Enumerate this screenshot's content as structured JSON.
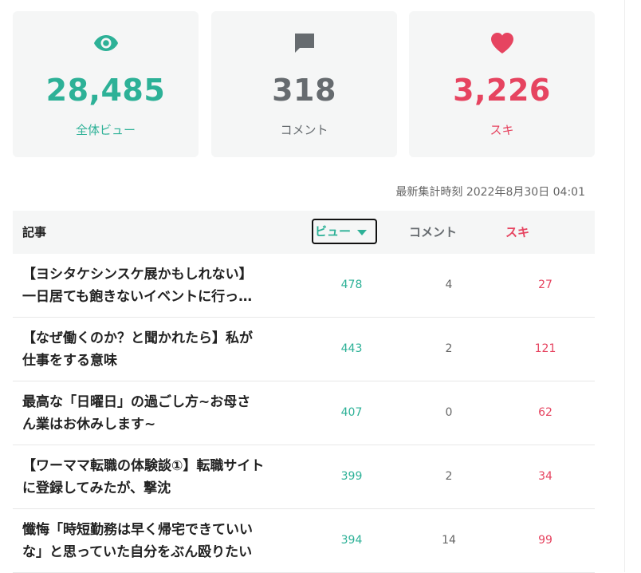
{
  "stats": [
    {
      "icon": "eye-icon",
      "value": "28,485",
      "label": "全体ビュー",
      "color": "#2db197"
    },
    {
      "icon": "comment-icon",
      "value": "318",
      "label": "コメント",
      "color": "#666b6f"
    },
    {
      "icon": "heart-icon",
      "value": "3,226",
      "label": "スキ",
      "color": "#e64460"
    }
  ],
  "timestamp": "最新集計時刻 2022年8月30日 04:01",
  "table": {
    "headers": {
      "title": "記事",
      "views": "ビュー",
      "comments": "コメント",
      "likes": "スキ"
    },
    "rows": [
      {
        "line1": "【ヨシタケシンスケ展かもしれない】",
        "line2": "一日居ても飽きないイベントに行っ…",
        "views": "478",
        "comments": "4",
        "likes": "27"
      },
      {
        "line1": "【なぜ働くのか？と聞かれたら】私が",
        "line2": "仕事をする意味",
        "views": "443",
        "comments": "2",
        "likes": "121"
      },
      {
        "line1": "最高な「日曜日」の過ごし方~お母さ",
        "line2": "ん業はお休みします~",
        "views": "407",
        "comments": "0",
        "likes": "62"
      },
      {
        "line1": "【ワーママ転職の体験談①】転職サイト",
        "line2": "に登録してみたが、撃沈",
        "views": "399",
        "comments": "2",
        "likes": "34"
      },
      {
        "line1": "懺悔「時短勤務は早く帰宅できていい",
        "line2": "な」と思っていた自分をぶん殴りたい",
        "views": "394",
        "comments": "14",
        "likes": "99"
      }
    ]
  },
  "colors": {
    "teal": "#2db197",
    "gray": "#666b6f",
    "red": "#e64460",
    "card_bg": "#f5f6f6"
  }
}
